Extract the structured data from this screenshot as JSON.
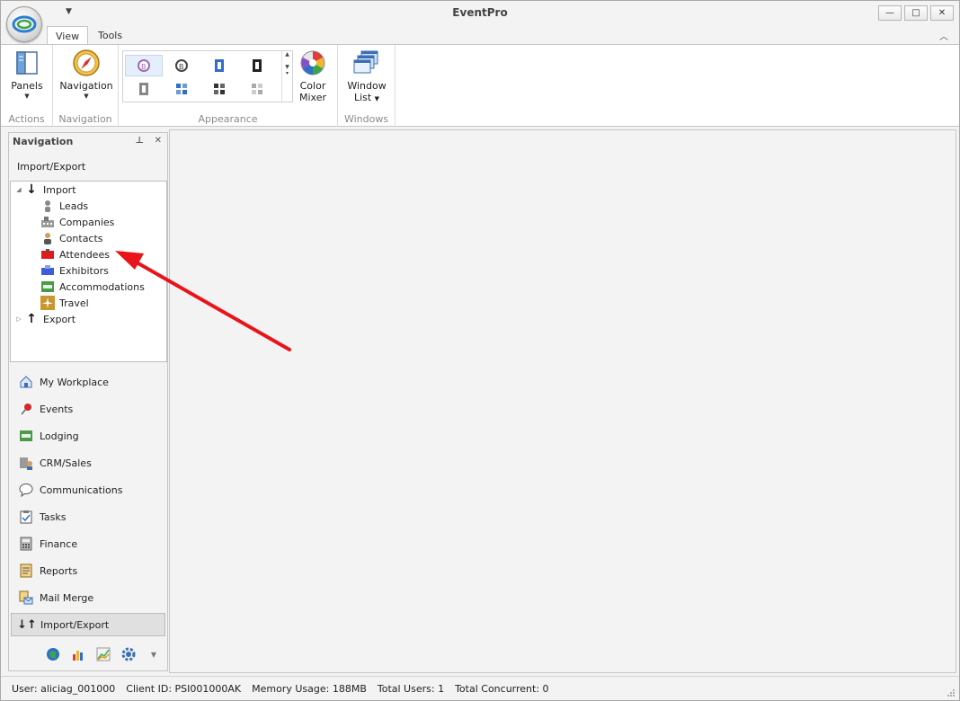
{
  "window": {
    "title": "EventPro",
    "minimize_glyph": "—",
    "maximize_glyph": "□",
    "close_glyph": "✕"
  },
  "ribbon": {
    "tabs": [
      {
        "label": "View",
        "active": true
      },
      {
        "label": "Tools",
        "active": false
      }
    ],
    "groups": {
      "actions": {
        "caption": "Actions",
        "panels_label": "Panels"
      },
      "navigation": {
        "caption": "Navigation",
        "navigation_label": "Navigation"
      },
      "appearance": {
        "caption": "Appearance",
        "color_mixer_line1": "Color",
        "color_mixer_line2": "Mixer"
      },
      "windows": {
        "caption": "Windows",
        "window_list_line1": "Window",
        "window_list_line2": "List"
      }
    }
  },
  "nav_panel": {
    "title": "Navigation",
    "section_title": "Import/Export",
    "tree": {
      "import_label": "Import",
      "import_items": [
        {
          "label": "Leads",
          "icon": "person-icon"
        },
        {
          "label": "Companies",
          "icon": "building-icon"
        },
        {
          "label": "Contacts",
          "icon": "contact-icon"
        },
        {
          "label": "Attendees",
          "icon": "attendee-badge-icon"
        },
        {
          "label": "Exhibitors",
          "icon": "exhibitor-icon"
        },
        {
          "label": "Accommodations",
          "icon": "bed-icon"
        },
        {
          "label": "Travel",
          "icon": "airplane-icon"
        }
      ],
      "export_label": "Export"
    },
    "buttons": [
      {
        "label": "My Workplace",
        "icon": "home-icon",
        "active": false
      },
      {
        "label": "Events",
        "icon": "pushpin-icon",
        "active": false
      },
      {
        "label": "Lodging",
        "icon": "bed-icon",
        "active": false
      },
      {
        "label": "CRM/Sales",
        "icon": "crm-icon",
        "active": false
      },
      {
        "label": "Communications",
        "icon": "speech-bubble-icon",
        "active": false
      },
      {
        "label": "Tasks",
        "icon": "clipboard-check-icon",
        "active": false
      },
      {
        "label": "Finance",
        "icon": "calculator-icon",
        "active": false
      },
      {
        "label": "Reports",
        "icon": "report-icon",
        "active": false
      },
      {
        "label": "Mail Merge",
        "icon": "mail-merge-icon",
        "active": false
      },
      {
        "label": "Import/Export",
        "icon": "import-export-icon",
        "active": true
      }
    ]
  },
  "status_bar": {
    "user": "User: aliciag_001000",
    "client_id": "Client ID: PSI001000AK",
    "memory": "Memory Usage: 188MB",
    "total_users": "Total Users: 1",
    "total_concurrent": "Total Concurrent: 0"
  },
  "colors": {
    "annotation_arrow": "#e8141a",
    "accent_blue": "#2e6fc9"
  }
}
